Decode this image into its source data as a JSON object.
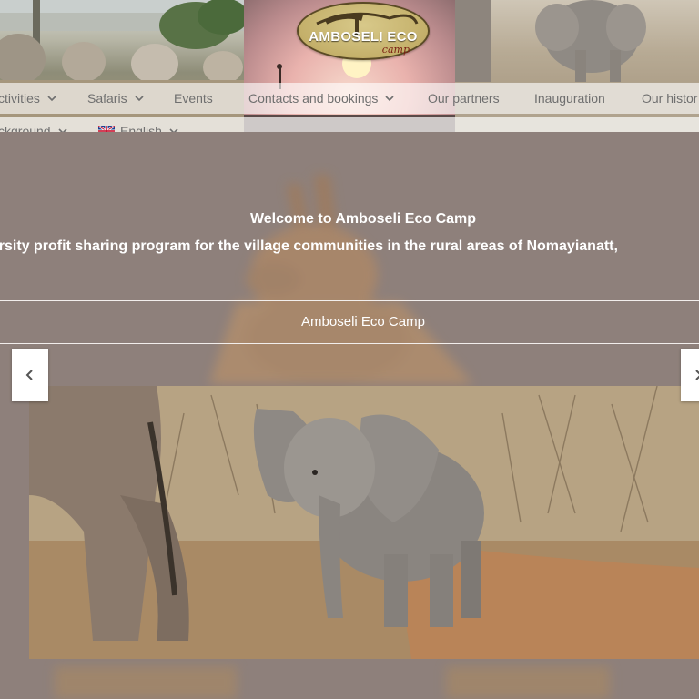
{
  "header": {
    "logo_title": "AMBOSELI ECO",
    "logo_sub": "camp"
  },
  "nav": {
    "row1": [
      {
        "label": "ctivities",
        "has_dropdown": true
      },
      {
        "label": "Safaris",
        "has_dropdown": true
      },
      {
        "label": "Events",
        "has_dropdown": false
      },
      {
        "label": "Contacts and bookings",
        "has_dropdown": true
      },
      {
        "label": "Our partners",
        "has_dropdown": false
      },
      {
        "label": "Inauguration",
        "has_dropdown": false
      },
      {
        "label": "Our histor",
        "has_dropdown": false
      }
    ],
    "row2": [
      {
        "label": "ckground",
        "has_dropdown": true
      },
      {
        "label": "English",
        "has_dropdown": true,
        "icon": "uk-flag-icon"
      }
    ]
  },
  "hero": {
    "welcome": "Welcome to Amboseli Eco Camp",
    "tagline": "odiversity profit sharing program for the village communities in the rural areas of Nomayianatt,",
    "subtitle": "Amboseli Eco Camp"
  },
  "slider": {
    "prev_icon": "chevron-left-icon",
    "next_icon": "chevron-right-icon"
  },
  "colors": {
    "background": "#8e807b",
    "nav_text": "#6f6f6f",
    "hero_text": "#ffffff"
  }
}
